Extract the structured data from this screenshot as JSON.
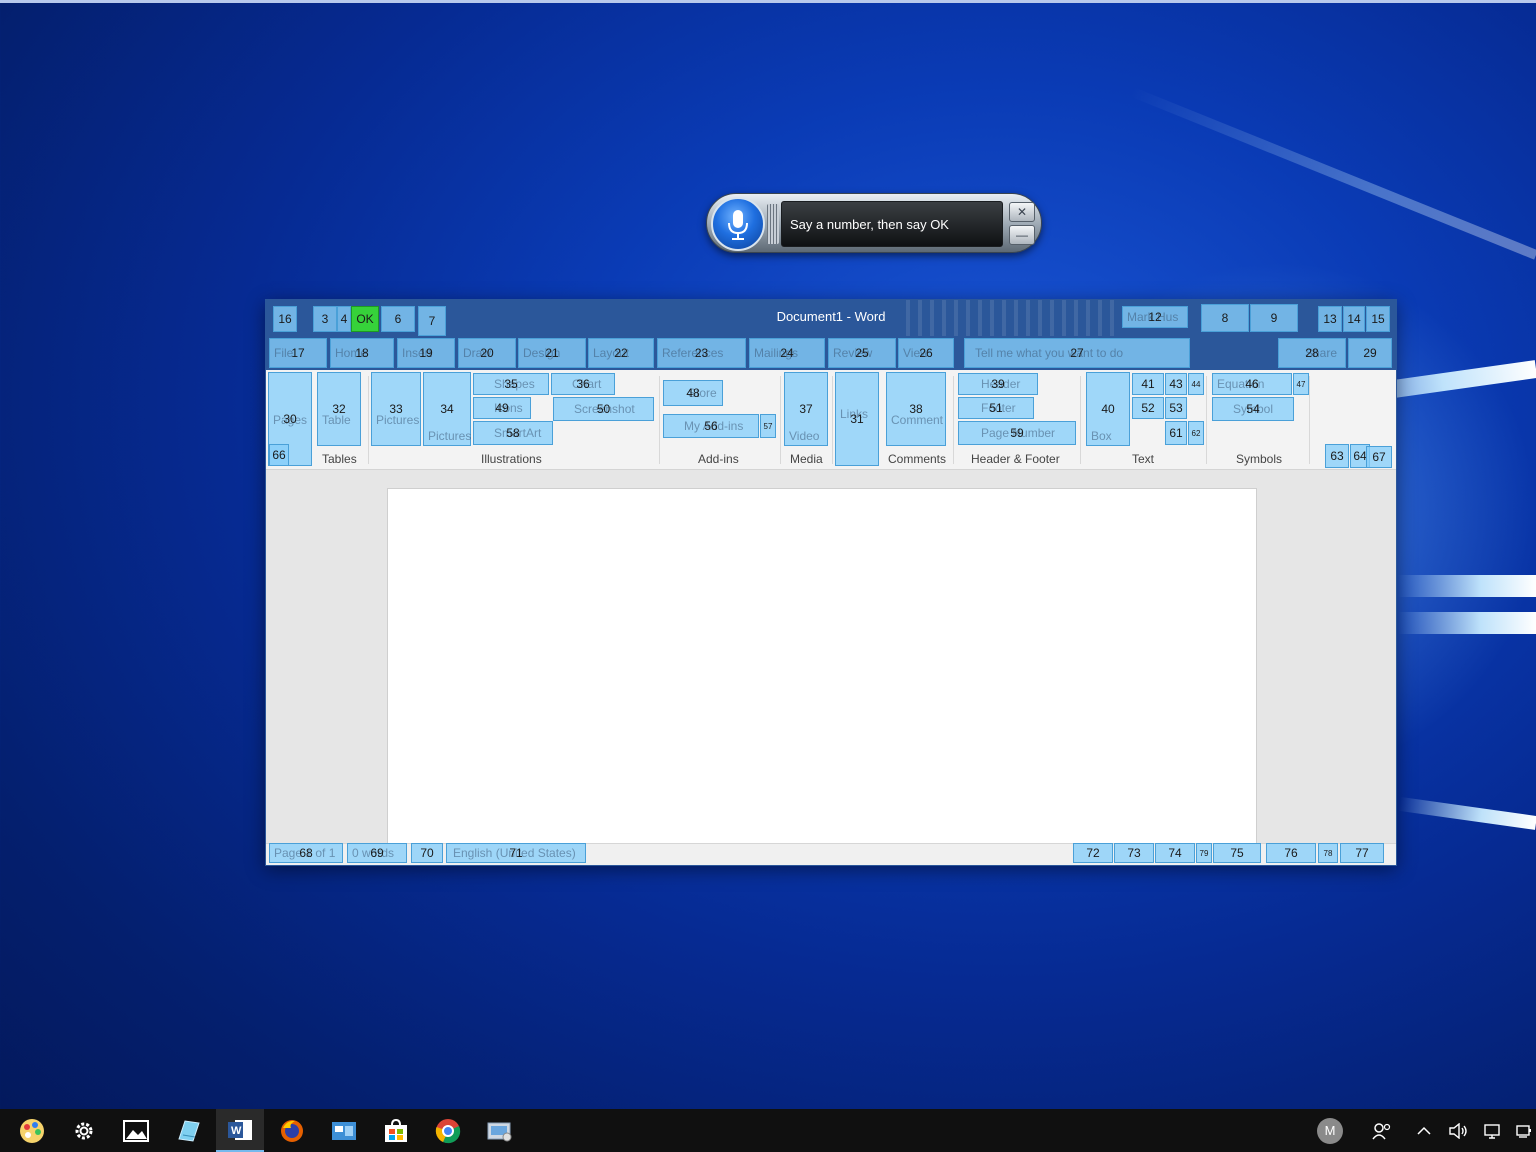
{
  "speech": {
    "message": "Say a number, then say OK",
    "close_glyph": "✕",
    "minimize_glyph": "—"
  },
  "word": {
    "title": "Document1  -  Word",
    "account": "Mark Hus",
    "tell_me": "Tell me what you want to do",
    "share": "Share",
    "tabs": [
      "File",
      "Home",
      "Insert",
      "Draw",
      "Design",
      "Layout",
      "References",
      "Mailings",
      "Review",
      "View"
    ],
    "groups": [
      "Tables",
      "Illustrations",
      "Add-ins",
      "Media",
      "Comments",
      "Header & Footer",
      "Text",
      "Symbols"
    ],
    "ribbon_labels": {
      "pages": "Pages",
      "table": "Table",
      "pictures": "Pictures",
      "online_pictures_1": "Online",
      "online_pictures_2": "Pictures",
      "shapes": "Shapes",
      "icons": "Icons",
      "smartart": "SmartArt",
      "chart": "Chart",
      "screenshot": "Screenshot",
      "store": "Store",
      "my_addins": "My Add-ins",
      "online_video_1": "Online",
      "online_video_2": "Video",
      "links": "Links",
      "comment": "Comment",
      "header": "Header",
      "footer": "Footer",
      "page_number": "Page Number",
      "text_box_1": "Text",
      "text_box_2": "Box",
      "equation": "Equation",
      "symbol": "Symbol"
    },
    "status": {
      "page": "Page 1 of 1",
      "words": "0 words",
      "language": "English (United States)"
    }
  },
  "overlays": [
    {
      "n": "16"
    },
    {
      "n": "3"
    },
    {
      "n": "4"
    },
    {
      "n": "OK"
    },
    {
      "n": "6"
    },
    {
      "n": "7"
    },
    {
      "n": "12"
    },
    {
      "n": "8"
    },
    {
      "n": "9"
    },
    {
      "n": "13"
    },
    {
      "n": "14"
    },
    {
      "n": "15"
    },
    {
      "n": "17"
    },
    {
      "n": "18"
    },
    {
      "n": "19"
    },
    {
      "n": "20"
    },
    {
      "n": "21"
    },
    {
      "n": "22"
    },
    {
      "n": "23"
    },
    {
      "n": "24"
    },
    {
      "n": "25"
    },
    {
      "n": "26"
    },
    {
      "n": "27"
    },
    {
      "n": "28"
    },
    {
      "n": "29"
    },
    {
      "n": "30"
    },
    {
      "n": "66"
    },
    {
      "n": "32"
    },
    {
      "n": "33"
    },
    {
      "n": "34"
    },
    {
      "n": "35"
    },
    {
      "n": "49"
    },
    {
      "n": "58"
    },
    {
      "n": "36"
    },
    {
      "n": "50"
    },
    {
      "n": "48"
    },
    {
      "n": "56"
    },
    {
      "n": "57"
    },
    {
      "n": "37"
    },
    {
      "n": "31"
    },
    {
      "n": "38"
    },
    {
      "n": "39"
    },
    {
      "n": "51"
    },
    {
      "n": "59"
    },
    {
      "n": "40"
    },
    {
      "n": "41"
    },
    {
      "n": "43"
    },
    {
      "n": "44"
    },
    {
      "n": "52"
    },
    {
      "n": "53"
    },
    {
      "n": "61"
    },
    {
      "n": "62"
    },
    {
      "n": "46"
    },
    {
      "n": "47"
    },
    {
      "n": "54"
    },
    {
      "n": "63"
    },
    {
      "n": "64"
    },
    {
      "n": "67"
    },
    {
      "n": "68"
    },
    {
      "n": "69"
    },
    {
      "n": "70"
    },
    {
      "n": "71"
    },
    {
      "n": "72"
    },
    {
      "n": "73"
    },
    {
      "n": "74"
    },
    {
      "n": "79"
    },
    {
      "n": "75"
    },
    {
      "n": "76"
    },
    {
      "n": "78"
    },
    {
      "n": "77"
    }
  ],
  "taskbar": {
    "avatar_initial": "M",
    "items": [
      "paint-icon",
      "settings-icon",
      "photos-icon",
      "notepad-icon",
      "word-icon",
      "firefox-icon",
      "file-explorer-icon",
      "store-icon",
      "chrome-icon",
      "control-panel-icon"
    ]
  },
  "colors": {
    "word_blue": "#2b579a",
    "overlay": "#87cefa",
    "ok_green": "#36d23a"
  }
}
